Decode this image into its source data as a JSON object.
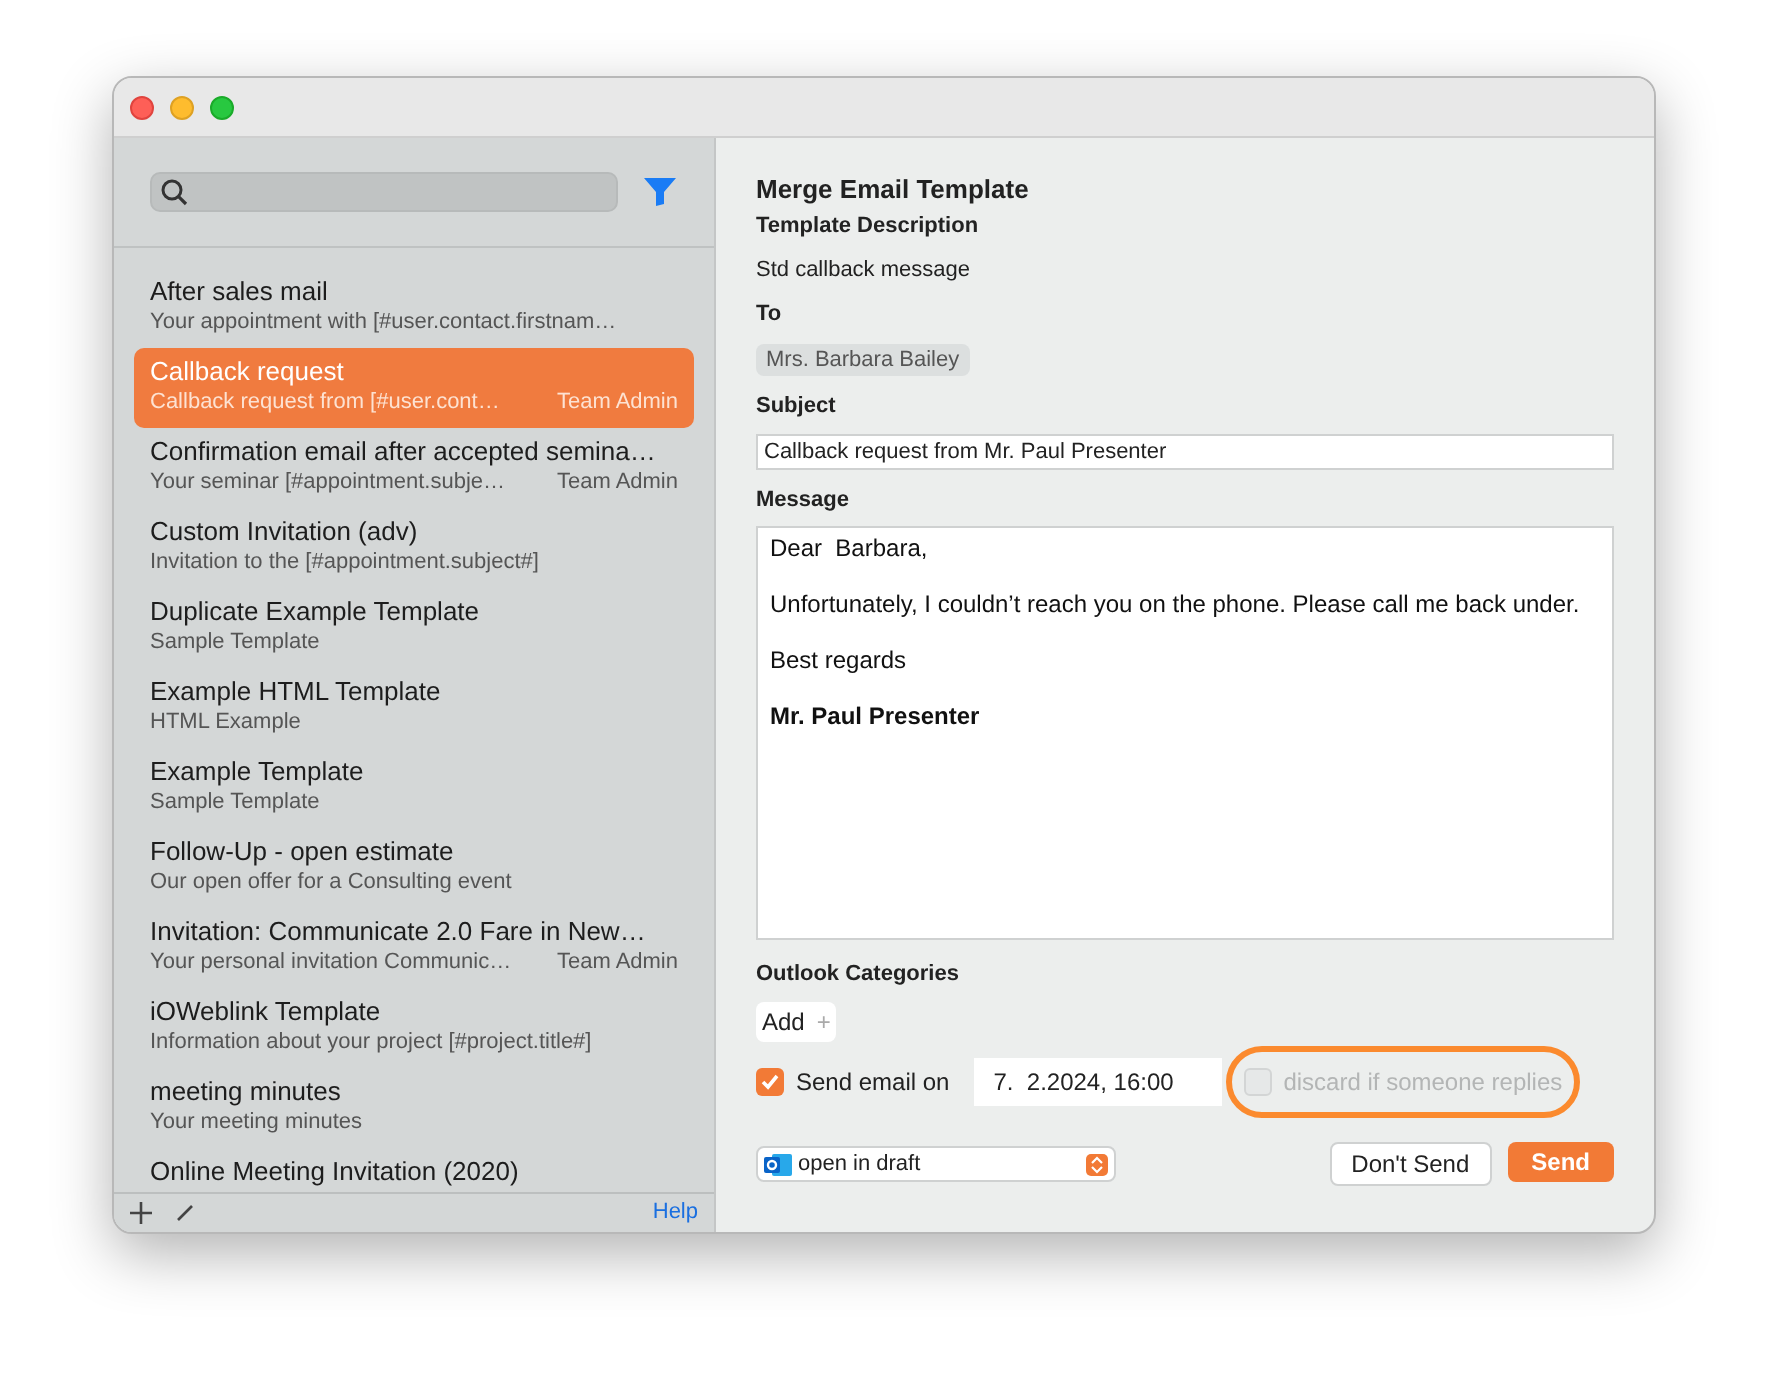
{
  "sidebar": {
    "items": [
      {
        "title": "After sales mail",
        "subtitle": "Your appointment with [#user.contact.firstnam…",
        "selected": false
      },
      {
        "title": "Callback request",
        "subtitle": "Callback request from [#user.cont…",
        "owner": "Team Admin",
        "selected": true
      },
      {
        "title": "Confirmation email after accepted semina…",
        "subtitle": "Your seminar [#appointment.subje…",
        "owner": "Team Admin",
        "selected": false
      },
      {
        "title": "Custom Invitation (adv)",
        "subtitle": "Invitation to the [#appointment.subject#]",
        "selected": false
      },
      {
        "title": "Duplicate Example Template",
        "subtitle": "Sample Template",
        "selected": false
      },
      {
        "title": "Example HTML Template",
        "subtitle": "HTML Example",
        "selected": false
      },
      {
        "title": "Example Template",
        "subtitle": "Sample Template",
        "selected": false
      },
      {
        "title": "Follow-Up - open estimate",
        "subtitle": "Our open offer for a Consulting event",
        "selected": false
      },
      {
        "title": "Invitation: Communicate 2.0 Fare in New…",
        "subtitle": "Your personal invitation Communic…",
        "owner": "Team Admin",
        "selected": false
      },
      {
        "title": "iOWeblink Template",
        "subtitle": "Information about your project [#project.title#]",
        "selected": false
      },
      {
        "title": "meeting minutes",
        "subtitle": "Your meeting minutes",
        "selected": false
      },
      {
        "title": "Online Meeting Invitation (2020)",
        "selected": false
      }
    ],
    "footer": {
      "help": "Help"
    }
  },
  "form": {
    "title": "Merge Email Template",
    "description_label": "Template Description",
    "description": "Std callback message",
    "to_label": "To",
    "recipient": "Mrs. Barbara Bailey",
    "subject_label": "Subject",
    "subject": "Callback request from Mr. Paul Presenter",
    "message_label": "Message",
    "message": [
      {
        "text": "Dear  Barbara,",
        "bold": false
      },
      {
        "text": "Unfortunately, I couldn’t reach you on the phone. Please call me back under.",
        "bold": false
      },
      {
        "text": "Best regards",
        "bold": false
      },
      {
        "text": "Mr. Paul Presenter",
        "bold": true
      }
    ],
    "categories_label": "Outlook Categories",
    "add_label": "Add",
    "add_icon": "+",
    "send_on": {
      "label": "Send email on",
      "checked": true,
      "value": "7.  2.2024, 16:00"
    },
    "discard": {
      "label": "discard if someone replies",
      "checked": false,
      "disabled": true,
      "highlighted": true
    },
    "mode": "open in draft",
    "buttons": [
      {
        "label": "Don't Send",
        "kind": "secondary"
      },
      {
        "label": "Send",
        "kind": "primary"
      }
    ]
  }
}
